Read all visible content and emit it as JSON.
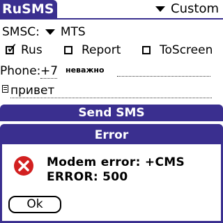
{
  "header": {
    "app_title": "RuSMS",
    "mode_value": "Custom"
  },
  "form": {
    "smsc_label": "SMSC:",
    "smsc_value": "MTS",
    "checkboxes": [
      {
        "label": "Rus",
        "checked": true
      },
      {
        "label": "Report",
        "checked": false
      },
      {
        "label": "ToScreen",
        "checked": false
      }
    ],
    "phone_label": "Phone:",
    "phone_prefix": "+7",
    "phone_hint": "неважно",
    "message_text": "привет"
  },
  "send_button": {
    "label": "Send SMS"
  },
  "dialog": {
    "title": "Error",
    "message_line1": "Modem error: +CMS",
    "message_line2": "ERROR: 500",
    "ok_label": "Ok"
  },
  "colors": {
    "accent": "#3a2f8f",
    "error_red": "#d22020"
  }
}
